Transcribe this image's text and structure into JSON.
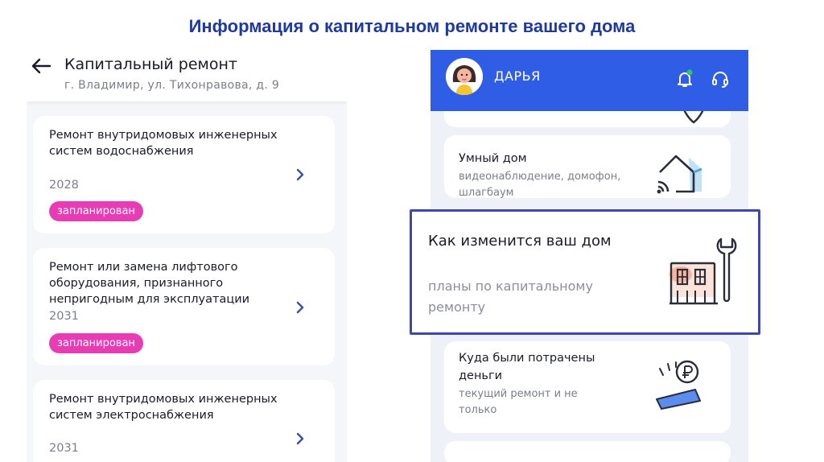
{
  "slide": {
    "title": "Информация о капитальном ремонте вашего дома"
  },
  "left": {
    "title": "Капитальный ремонт",
    "address": "г. Владимир, ул. Тихонравова,  д. 9",
    "items": [
      {
        "title": "Ремонт внутридомовых инженерных систем водоснабжения",
        "year": "2028",
        "status": "запланирован"
      },
      {
        "title": "Ремонт или замена лифтового оборудования, признанного непригодным для эксплуатации",
        "year": "2031",
        "status": "запланирован"
      },
      {
        "title": "Ремонт внутридомовых инженерных систем электроснабжения",
        "year": "2031"
      }
    ]
  },
  "right": {
    "user_name": "ДАРЬЯ",
    "services": [
      {
        "title": "Умный дом",
        "desc": "видеонаблюдение, домофон, шлагбаум",
        "icon": "smart-home-icon"
      },
      {
        "title": "Куда были потрачены деньги",
        "desc": "текущий ремонт и не только",
        "icon": "money-icon"
      }
    ],
    "highlight": {
      "title": "Как изменится ваш дом",
      "desc": "планы по капитальному ремонту",
      "icon": "house-repair-icon"
    }
  },
  "colors": {
    "title": "#1f3a9e",
    "badge": "#e83cb4",
    "header_blue": "#2f5de5",
    "highlight_border": "#3d48a8",
    "chevron": "#3b4fa6"
  }
}
